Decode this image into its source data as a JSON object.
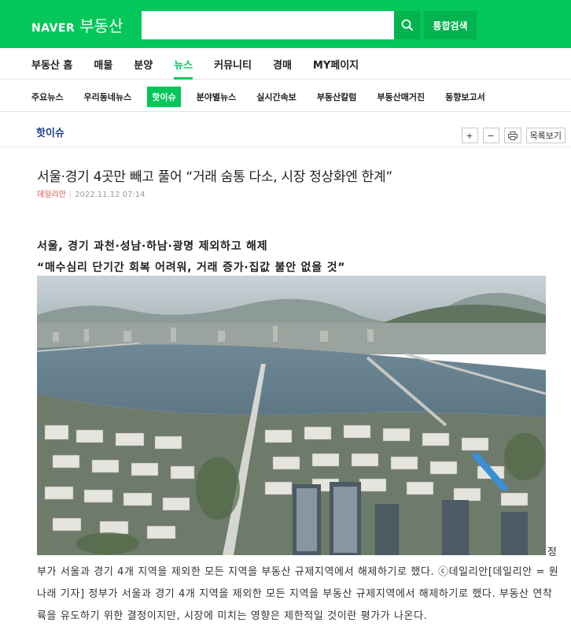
{
  "header": {
    "brand": "NAVER",
    "service": "부동산",
    "search_value": "",
    "search_icon": "search-icon",
    "integrated_search_label": "통합검색"
  },
  "main_nav": {
    "items": [
      {
        "label": "부동산 홈",
        "active": false
      },
      {
        "label": "매물",
        "active": false
      },
      {
        "label": "분양",
        "active": false
      },
      {
        "label": "뉴스",
        "active": true
      },
      {
        "label": "커뮤니티",
        "active": false
      },
      {
        "label": "경매",
        "active": false
      },
      {
        "label": "MY페이지",
        "active": false
      }
    ]
  },
  "sub_nav": {
    "items": [
      {
        "label": "주요뉴스",
        "active": false
      },
      {
        "label": "우리동네뉴스",
        "active": false
      },
      {
        "label": "핫이슈",
        "active": true
      },
      {
        "label": "분야별뉴스",
        "active": false
      },
      {
        "label": "실시간속보",
        "active": false
      },
      {
        "label": "부동산칼럼",
        "active": false
      },
      {
        "label": "부동산매거진",
        "active": false
      },
      {
        "label": "동향보고서",
        "active": false
      }
    ]
  },
  "section": {
    "title": "핫이슈",
    "tools": {
      "zoom_in": "+",
      "zoom_out": "−",
      "print_icon": "print-icon",
      "list_label": "목록보기"
    }
  },
  "article": {
    "headline": "서울·경기 4곳만 빼고 풀어 “거래 숨통 다소, 시장 정상화엔 한계”",
    "press": "데일리안",
    "datetime": "2022.11.12 07:14",
    "subheads": [
      "서울, 경기 과천·성남·하남·광명 제외하고 해제",
      "“매수심리 단기간 회복 어려워, 거래 증가·집값 불안 없을 것”"
    ],
    "caption_lead": "정",
    "body": "부가 서울과 경기 4개 지역을 제외한 모든 지역을 부동산 규제지역에서 해제하기로 했다. ⓒ데일리안[데일리안 = 원나래 기자] 정부가 서울과 경기 4개 지역을 제외한 모든 지역을 부동산 규제지역에서 해제하기로 했다. 부동산 연착륙을 유도하기 위한 결정이지만, 시장에 미치는 영향은 제한적일 것이란 평가가 나온다."
  },
  "colors": {
    "brand_green": "#03c75a",
    "section_title": "#1a3f8a",
    "press_red": "#d9534f"
  }
}
